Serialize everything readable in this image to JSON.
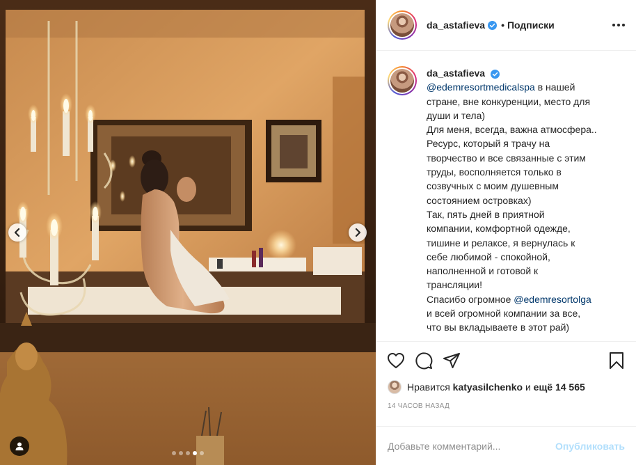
{
  "post": {
    "username": "da_astafieva",
    "follow_label": "Подписки",
    "bullet": "•",
    "caption": {
      "username": "da_astafieva",
      "lines": [
        {
          "mention": "@edemresortmedicalspa",
          "text": " в нашей"
        },
        {
          "text": "стране, вне конкуренции, место для"
        },
        {
          "text": "души и тела)"
        },
        {
          "text": "Для меня, всегда, важна атмосфера.."
        },
        {
          "text": "Ресурс, который я трачу на"
        },
        {
          "text": "творчество и все связанные с этим"
        },
        {
          "text": "труды, восполняется только в"
        },
        {
          "text": "созвучных с моим душевным"
        },
        {
          "text": "состоянием островках)"
        },
        {
          "text": "Так, пять дней в приятной"
        },
        {
          "text": "компании, комфортной одежде,"
        },
        {
          "text": "тишине и релаксе, я вернулась к"
        },
        {
          "text": "себе любимой - спокойной,"
        },
        {
          "text": "наполненной и готовой к"
        },
        {
          "text": "трансляции!"
        },
        {
          "pre": "Спасибо огромное ",
          "mention": "@edemresortolga"
        },
        {
          "text": "и всей огромной компании за все,"
        },
        {
          "text": "что вы вкладываете в этот рай)"
        }
      ]
    },
    "likes": {
      "prefix": "Нравится ",
      "user": "katyasilchenko",
      "middle": " и ",
      "others": "ещё 14 565"
    },
    "time_ago": "14 ЧАСОВ НАЗАД",
    "comment": {
      "placeholder": "Добавьте комментарий...",
      "post_label": "Опубликовать"
    },
    "carousel": {
      "slide_count": 5,
      "active_index": 3
    }
  },
  "icons": {
    "verified": "verified-badge-icon",
    "more": "more-options-icon",
    "like": "heart-icon",
    "comment": "comment-icon",
    "share": "paper-plane-icon",
    "save": "bookmark-icon",
    "prev": "chevron-left-icon",
    "next": "chevron-right-icon",
    "tags": "user-tag-icon"
  },
  "colors": {
    "verified": "#3897f0",
    "mention": "#00376b",
    "post_disabled": "#b2dffc",
    "meta": "#8e8e8e"
  }
}
